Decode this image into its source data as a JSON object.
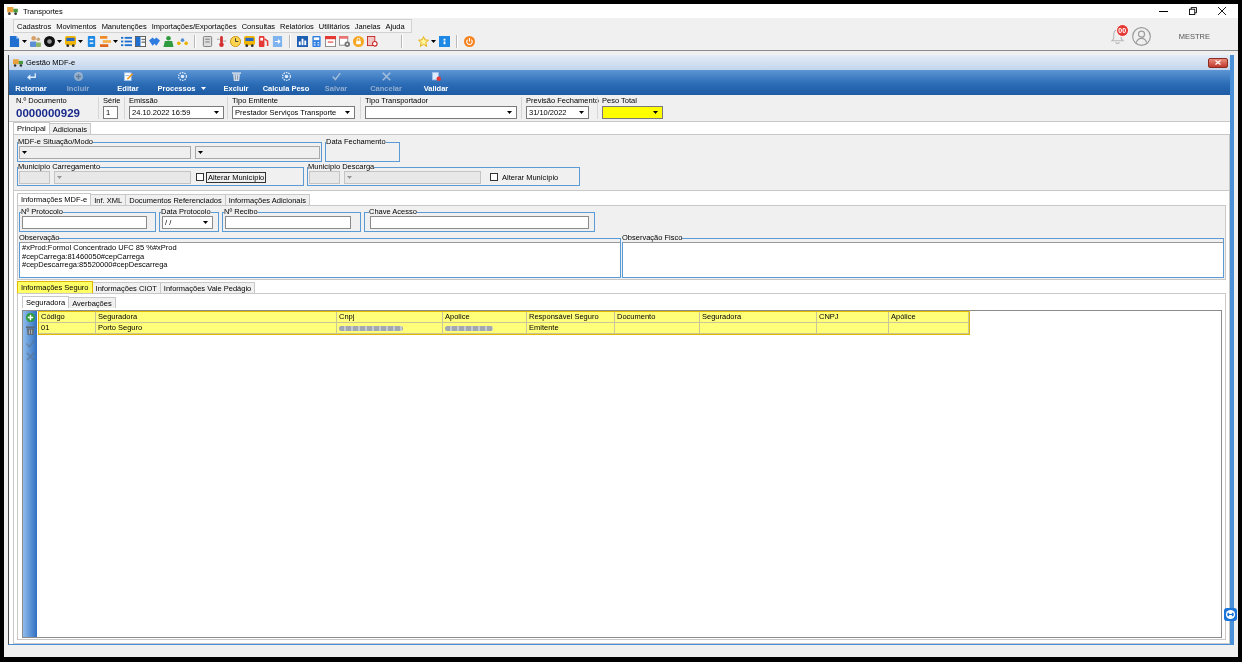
{
  "window": {
    "title": "Transportes"
  },
  "menu": [
    "Cadastros",
    "Movimentos",
    "Manutenções",
    "Importações/Exportações",
    "Consultas",
    "Relatórios",
    "Utilitários",
    "Janelas",
    "Ajuda"
  ],
  "notifications": {
    "count": "00"
  },
  "user": {
    "name": "MESTRE"
  },
  "child_window": {
    "title": "Gestão MDF-e"
  },
  "ribbon": [
    {
      "label": "Retornar",
      "disabled": false,
      "menu": false
    },
    {
      "label": "Incluir",
      "disabled": true,
      "menu": false
    },
    {
      "label": "Editar",
      "disabled": false,
      "menu": false
    },
    {
      "label": "Processos",
      "disabled": false,
      "menu": true
    },
    {
      "label": "Excluir",
      "disabled": false,
      "menu": false
    },
    {
      "label": "Calcula Peso",
      "disabled": false,
      "menu": false
    },
    {
      "label": "Salvar",
      "disabled": true,
      "menu": false
    },
    {
      "label": "Cancelar",
      "disabled": true,
      "menu": false
    },
    {
      "label": "Validar",
      "disabled": false,
      "menu": false
    }
  ],
  "header": {
    "document": {
      "label": "N.º Documento",
      "value": "0000000929"
    },
    "fields": [
      {
        "label": "Série",
        "kind": "text",
        "value": "1",
        "highlighted": false
      },
      {
        "label": "Emissão",
        "kind": "dropdown",
        "value": "24.10.2022 16:59",
        "highlighted": false
      },
      {
        "label": "Tipo Emitente",
        "kind": "dropdown",
        "value": "Prestador Serviços Transporte",
        "highlighted": false
      },
      {
        "label": "Tipo Transportador",
        "kind": "dropdown",
        "highlighted": false
      },
      {
        "label": "Previsão Fechamento",
        "kind": "dropdown",
        "value": "31/10/2022",
        "highlighted": false
      },
      {
        "label": "Peso Total",
        "kind": "dropdown",
        "highlighted": true
      }
    ]
  },
  "main_tabs": [
    {
      "label": "Principal",
      "selected": true
    },
    {
      "label": "Adicionais",
      "selected": false
    }
  ],
  "principal": {
    "situacao": {
      "title": "MDF-e Situação/Modo",
      "fields": [
        {
          "kind": "dropdown",
          "disabled": false
        },
        {
          "kind": "dropdown",
          "disabled": false
        }
      ]
    },
    "data_fechamento": {
      "title": "Data Fechamento"
    },
    "municipios": [
      {
        "title": "Município Carregamento",
        "fields": [
          {
            "kind": "text",
            "disabled": true
          },
          {
            "kind": "dropdown",
            "disabled": true
          }
        ],
        "checkbox": {
          "label": "Alterar Município",
          "checked": false,
          "focused": true
        }
      },
      {
        "title": "Município Descarga",
        "fields": [
          {
            "kind": "text",
            "disabled": true
          },
          {
            "kind": "dropdown",
            "disabled": true
          }
        ],
        "checkbox": {
          "label": "Alterar Município",
          "checked": false,
          "focused": false
        }
      }
    ]
  },
  "info_tabs": [
    {
      "label": "Informações MDF-e",
      "selected": true
    },
    {
      "label": "Inf. XML",
      "selected": false
    },
    {
      "label": "Documentos Referenciados",
      "selected": false
    },
    {
      "label": "Informações Adicionais",
      "selected": false
    }
  ],
  "info_mdfe": {
    "fields": [
      {
        "label": "Nº Protocolo",
        "kind": "text"
      },
      {
        "label": "Data Protocolo",
        "kind": "dropdown",
        "value": "/ /"
      },
      {
        "label": "Nº Recibo",
        "kind": "text"
      },
      {
        "label": "Chave Acesso",
        "kind": "text"
      }
    ],
    "observacao": {
      "label": "Observação",
      "lines": [
        "#xProd:Formol Concentrado UFC 85 %#xProd",
        "#cepCarrega:81460050#cepCarrega",
        "#cepDescarrega:85520000#cepDescarrega"
      ]
    },
    "observacao_fisco": {
      "label": "Observação Fisco"
    }
  },
  "seguro_tabs": [
    {
      "label": "Informações Seguro",
      "selected": true,
      "highlighted": true
    },
    {
      "label": "Informações CIOT",
      "selected": false,
      "highlighted": false
    },
    {
      "label": "Informações Vale Pedágio",
      "selected": false,
      "highlighted": false
    }
  ],
  "seguro_subtabs": [
    {
      "label": "Seguradora",
      "selected": true
    },
    {
      "label": "Averbações",
      "selected": false
    }
  ],
  "grid_actions": [
    {
      "disabled": false
    },
    {
      "disabled": false
    },
    {
      "disabled": true
    },
    {
      "disabled": true
    }
  ],
  "table": {
    "highlighted": true,
    "columns": [
      "Código",
      "Seguradora",
      "Cnpj",
      "Apolice",
      "Responsável Seguro",
      "Documento",
      "Seguradora",
      "CNPJ",
      "Apólice"
    ],
    "rows": [
      {
        "cells": [
          {
            "kind": "text",
            "text": "01"
          },
          {
            "kind": "text",
            "text": "Porto Seguro"
          },
          {
            "kind": "blurred"
          },
          {
            "kind": "blurred"
          },
          {
            "kind": "text",
            "text": "Emitente"
          }
        ]
      }
    ]
  }
}
